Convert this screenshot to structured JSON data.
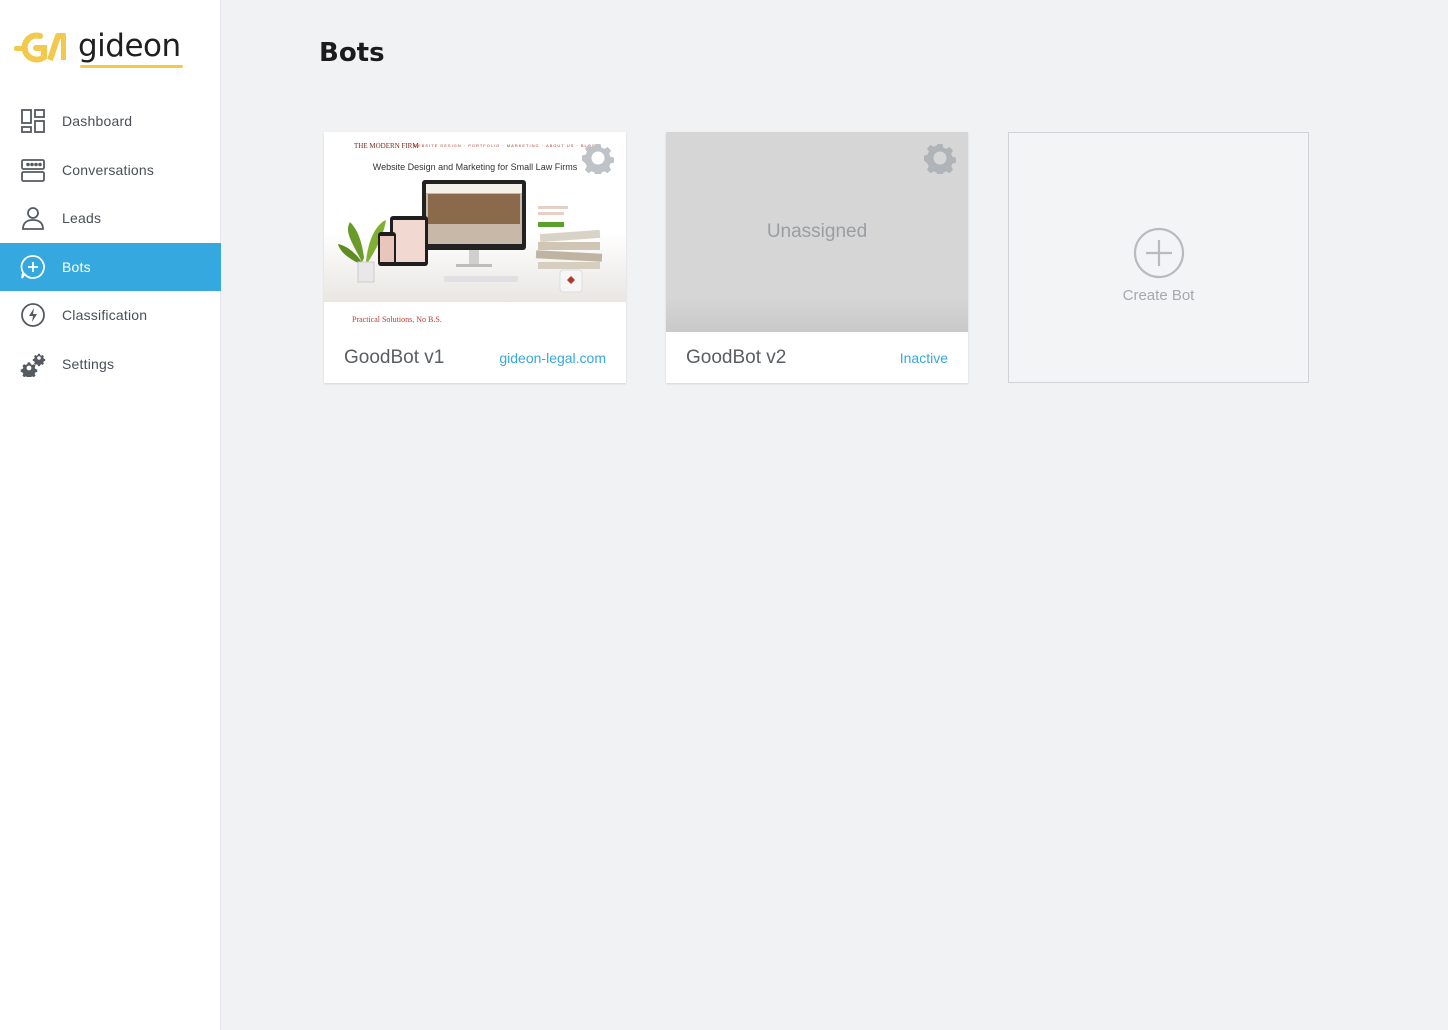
{
  "brand": {
    "name": "gideon",
    "accent": "#f2c94c"
  },
  "sidebar": {
    "items": [
      {
        "label": "Dashboard",
        "icon": "dashboard-icon",
        "active": false
      },
      {
        "label": "Conversations",
        "icon": "conversations-icon",
        "active": false
      },
      {
        "label": "Leads",
        "icon": "user-icon",
        "active": false
      },
      {
        "label": "Bots",
        "icon": "chat-plus-icon",
        "active": true
      },
      {
        "label": "Classification",
        "icon": "bolt-icon",
        "active": false
      },
      {
        "label": "Settings",
        "icon": "gears-icon",
        "active": false
      }
    ],
    "active_color": "#35a8e0"
  },
  "main": {
    "title": "Bots",
    "bots": [
      {
        "name": "GoodBot v1",
        "status": "gideon-legal.com",
        "thumbnail": {
          "brand": "THE MODERN FIRM",
          "nav": "WEBSITE DESIGN · PORTFOLIO · MARKETING · ABOUT US · BLOG",
          "headline": "Website Design and Marketing for Small Law Firms",
          "subheadline": "Practical Solutions, No B.S."
        }
      },
      {
        "name": "GoodBot v2",
        "status": "Inactive",
        "thumbnail_text": "Unassigned"
      }
    ],
    "create_label": "Create Bot"
  }
}
